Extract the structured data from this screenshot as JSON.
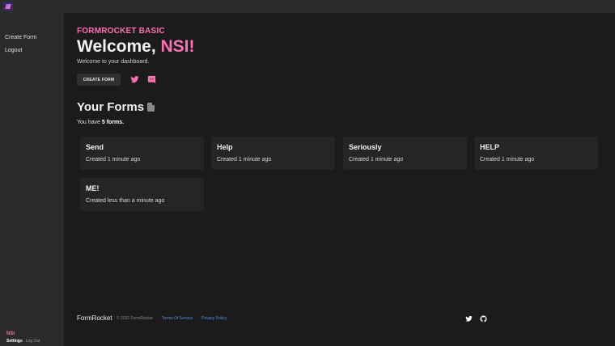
{
  "sidebar": {
    "items": [
      {
        "label": "Create Form"
      },
      {
        "label": "Logout"
      }
    ],
    "user": {
      "name": "NSI",
      "settings_label": "Settings",
      "logout_label": "Log Out"
    }
  },
  "header": {
    "brand": "FORMROCKET BASIC",
    "welcome_prefix": "Welcome, ",
    "welcome_name": "NSI!",
    "subtitle": "Welcome to your dashboard.",
    "create_button": "CREATE FORM",
    "icons": [
      "twitter-icon",
      "discord-icon"
    ]
  },
  "forms": {
    "title": "Your Forms",
    "count_prefix": "You have ",
    "count_value": "5 forms.",
    "cards": [
      {
        "title": "Send",
        "meta": "Created 1 minute ago"
      },
      {
        "title": "Help",
        "meta": "Created 1 minute ago"
      },
      {
        "title": "Seriously",
        "meta": "Created 1 minute ago"
      },
      {
        "title": "HELP",
        "meta": "Created 1 minute ago"
      },
      {
        "title": "ME!",
        "meta": "Created less than a minute ago"
      }
    ]
  },
  "footer": {
    "brand": "FormRocket",
    "copyright": "© 2022 FormRocket",
    "links": [
      "Terms Of Service",
      "Privacy Policy"
    ],
    "icons": [
      "twitter-icon",
      "github-icon"
    ]
  },
  "colors": {
    "accent": "#ff6fb3",
    "link": "#4e8ef7",
    "background": "#1b1b1b",
    "sidebar": "#2a2a2a",
    "card": "#252525"
  }
}
